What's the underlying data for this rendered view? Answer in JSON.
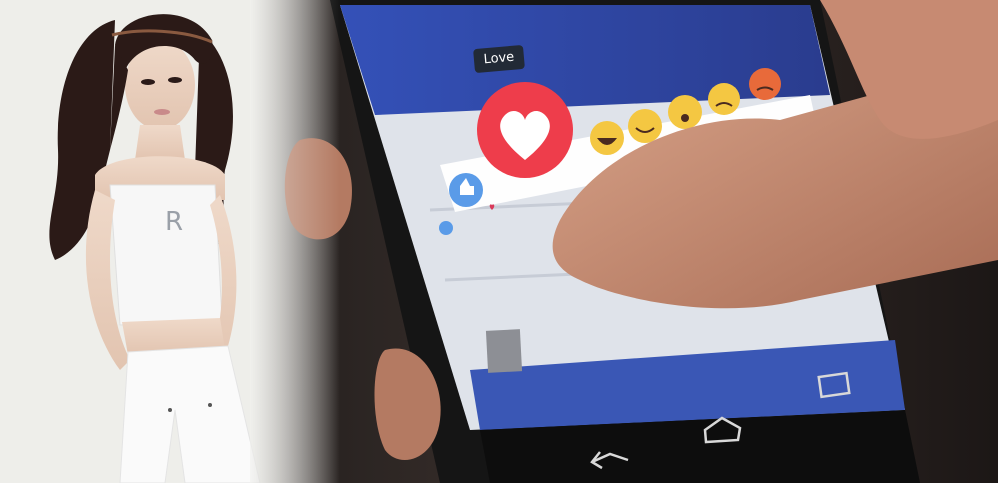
{
  "reaction_tooltip": {
    "label": "Love"
  },
  "reactions": [
    {
      "name": "love",
      "emoji": "heart"
    },
    {
      "name": "haha",
      "emoji": "laughing-face"
    },
    {
      "name": "wow",
      "emoji": "happy-face"
    },
    {
      "name": "sad",
      "emoji": "surprised-face"
    },
    {
      "name": "angry",
      "emoji": "sad-face"
    },
    {
      "name": "angry2",
      "emoji": "angry-face"
    }
  ],
  "colors": {
    "facebook_blue": "#3b5998",
    "love_red": "#ee3d4b",
    "emoji_yellow": "#f4c742",
    "angry_orange": "#e86a3a"
  }
}
